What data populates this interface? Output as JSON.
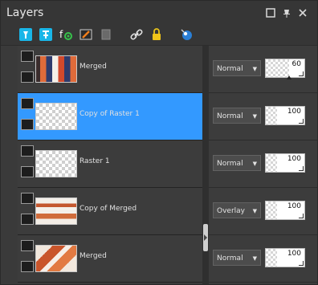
{
  "window": {
    "title": "Layers",
    "controls": [
      "restore-icon",
      "pin-icon",
      "close-icon"
    ]
  },
  "toolbar": {
    "tools": [
      {
        "name": "new-raster-layer-icon"
      },
      {
        "name": "new-vector-layer-icon"
      },
      {
        "name": "new-adjustment-layer-icon"
      },
      {
        "name": "new-mask-layer-icon"
      },
      {
        "name": "delete-layer-icon"
      },
      {
        "name": "link-layer-icon"
      },
      {
        "name": "lock-icon"
      },
      {
        "name": "view-icon"
      }
    ]
  },
  "layers": [
    {
      "name": "Merged",
      "blend": "Normal",
      "opacity": "60",
      "selected": false,
      "thumb": "merged-1"
    },
    {
      "name": "Copy of Raster 1",
      "blend": "Normal",
      "opacity": "100",
      "selected": true,
      "thumb": "transparent"
    },
    {
      "name": "Raster 1",
      "blend": "Normal",
      "opacity": "100",
      "selected": false,
      "thumb": "transparent"
    },
    {
      "name": "Copy of Merged",
      "blend": "Overlay",
      "opacity": "100",
      "selected": false,
      "thumb": "copy-merged"
    },
    {
      "name": "Merged",
      "blend": "Normal",
      "opacity": "100",
      "selected": false,
      "thumb": "merged-2"
    }
  ],
  "colors": {
    "selection": "#3399ff",
    "panel": "#3c3c3c",
    "titlebar": "#363636"
  }
}
